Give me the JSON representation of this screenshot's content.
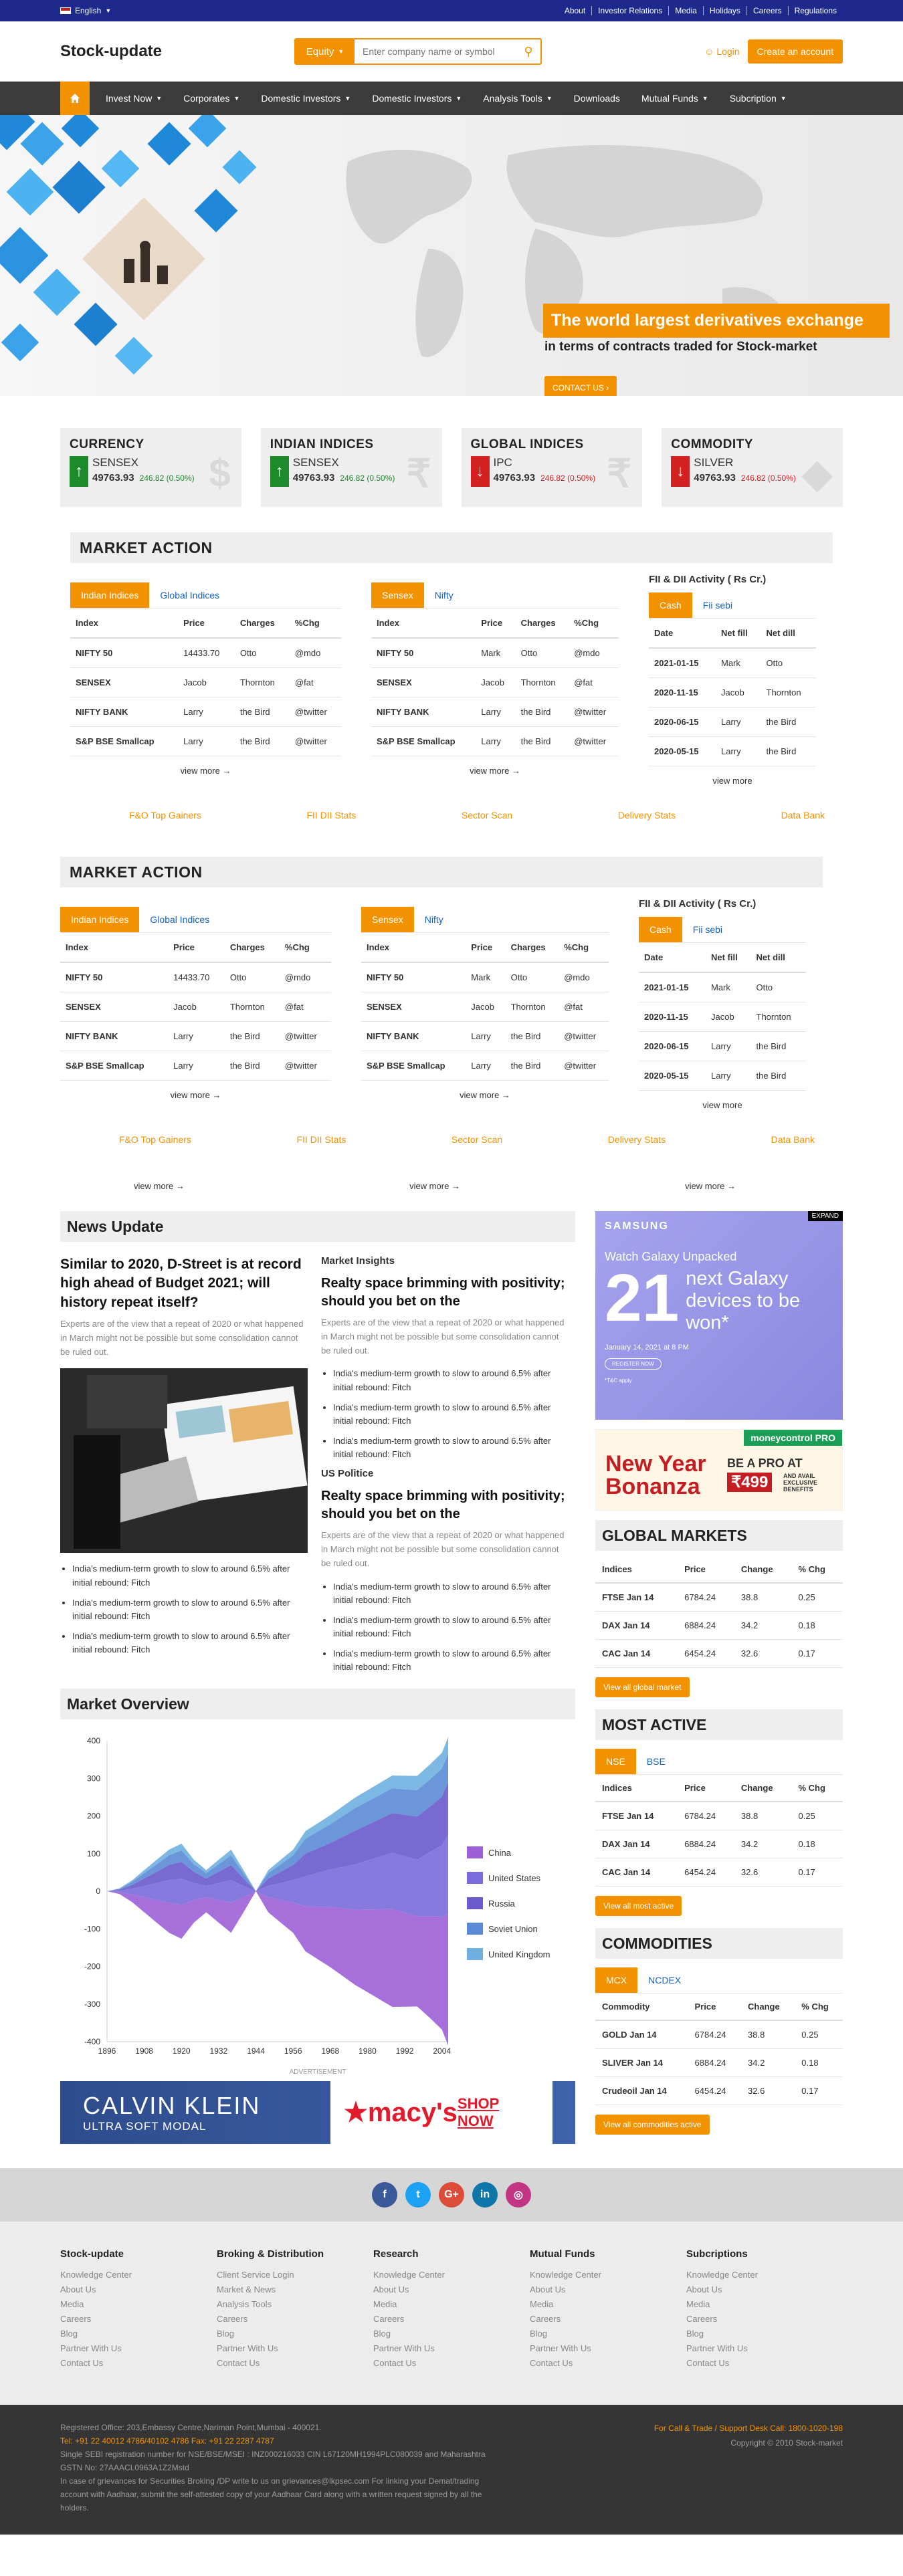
{
  "topbar": {
    "language": "English",
    "links": [
      "About",
      "Investor Relations",
      "Media",
      "Holidays",
      "Careers",
      "Regulations"
    ]
  },
  "header": {
    "logo": "Stock-update",
    "search_select": "Equity",
    "search_placeholder": "Enter company name or symbol",
    "login": "Login",
    "create_account": "Create an account"
  },
  "nav": {
    "items": [
      "Invest Now",
      "Corporates",
      "Domestic Investors",
      "Domestic Investors",
      "Analysis Tools",
      "Downloads",
      "Mutual Funds",
      "Subcription"
    ]
  },
  "hero": {
    "title": "The world largest derivatives exchange",
    "subtitle": "in terms of contracts traded for Stock-market",
    "button": "CONTACT US"
  },
  "cards": [
    {
      "title": "CURRENCY",
      "name": "SENSEX",
      "value": "49763.93",
      "change": "246.82 (0.50%)",
      "direction": "up",
      "symbol": "$"
    },
    {
      "title": "INDIAN INDICES",
      "name": "SENSEX",
      "value": "49763.93",
      "change": "246.82 (0.50%)",
      "direction": "up",
      "symbol": "₹"
    },
    {
      "title": "GLOBAL INDICES",
      "name": "IPC",
      "value": "49763.93",
      "change": "246.82 (0.50%)",
      "direction": "down",
      "symbol": "₹"
    },
    {
      "title": "COMMODITY",
      "name": "SILVER",
      "value": "49763.93",
      "change": "246.82 (0.50%)",
      "direction": "down",
      "symbol": "◆"
    }
  ],
  "market_action": {
    "title": "MARKET ACTION",
    "tabs1": [
      "Indian Indices",
      "Global Indices"
    ],
    "tabs2": [
      "Sensex",
      "Nifty"
    ],
    "headers": [
      "Index",
      "Price",
      "Charges",
      "%Chg"
    ],
    "rows1": [
      [
        "NIFTY 50",
        "14433.70",
        "Otto",
        "@mdo"
      ],
      [
        "SENSEX",
        "Jacob",
        "Thornton",
        "@fat"
      ],
      [
        "NIFTY BANK",
        "Larry",
        "the Bird",
        "@twitter"
      ],
      [
        "S&P BSE Smallcap",
        "Larry",
        "the Bird",
        "@twitter"
      ]
    ],
    "rows2": [
      [
        "NIFTY 50",
        "Mark",
        "Otto",
        "@mdo"
      ],
      [
        "SENSEX",
        "Jacob",
        "Thornton",
        "@fat"
      ],
      [
        "NIFTY BANK",
        "Larry",
        "the Bird",
        "@twitter"
      ],
      [
        "S&P BSE Smallcap",
        "Larry",
        "the Bird",
        "@twitter"
      ]
    ],
    "view_more": "view more",
    "fii_title": "FII & DII Activity ( Rs Cr.)",
    "fii_tabs": [
      "Cash",
      "Fii sebi"
    ],
    "fii_headers": [
      "Date",
      "Net fill",
      "Net dill"
    ],
    "fii_rows": [
      [
        "2021-01-15",
        "Mark",
        "Otto"
      ],
      [
        "2020-11-15",
        "Jacob",
        "Thornton"
      ],
      [
        "2020-06-15",
        "Larry",
        "the Bird"
      ],
      [
        "2020-05-15",
        "Larry",
        "the Bird"
      ]
    ],
    "links": [
      "F&O Top Gainers",
      "FII DII Stats",
      "Sector Scan",
      "Delivery Stats",
      "Data Bank"
    ]
  },
  "news": {
    "title": "News Update",
    "main_headline": "Similar to 2020, D-Street is at record high ahead of Budget 2021; will history repeat itself?",
    "main_text": "Experts are of the view that a repeat of 2020 or what happened in March might not be possible but some consolidation cannot be ruled out.",
    "bullet": "India's medium-term growth to slow to around 6.5% after initial rebound: Fitch",
    "insights_label": "Market Insights",
    "insights_headline": "Realty space brimming with positivity; should you bet on the",
    "insights_text": "Experts are of the view that a repeat of 2020 or what happened in March might not be possible but some consolidation cannot be ruled out.",
    "politics_label": "US Politice",
    "politics_headline": "Realty space brimming with positivity; should you bet on the",
    "politics_text": "Experts are of the view that a repeat of 2020 or what happened in March might not be possible but some consolidation cannot be ruled out."
  },
  "market_overview": {
    "title": "Market Overview"
  },
  "chart_data": {
    "type": "area",
    "x": [
      1896,
      1900,
      1904,
      1908,
      1912,
      1916,
      1920,
      1924,
      1928,
      1932,
      1936,
      1940,
      1944,
      1948,
      1952,
      1956,
      1960,
      1964,
      1968,
      1972,
      1976,
      1980,
      1984,
      1988,
      1992,
      1996,
      2000,
      2004,
      2006
    ],
    "x_ticks": [
      1896,
      1908,
      1920,
      1932,
      1944,
      1956,
      1968,
      1980,
      1992,
      2004
    ],
    "ylim": [
      -400,
      400
    ],
    "y_ticks": [
      400,
      300,
      200,
      100,
      0,
      -100,
      -200,
      -300,
      -400
    ],
    "series": [
      {
        "name": "China",
        "color": "#9c5fd6",
        "values": [
          0,
          5,
          20,
          40,
          60,
          80,
          90,
          60,
          40,
          60,
          80,
          40,
          0,
          40,
          60,
          80,
          120,
          140,
          160,
          180,
          200,
          220,
          240,
          260,
          250,
          240,
          270,
          300,
          350
        ]
      },
      {
        "name": "United States",
        "color": "#7a6bdc",
        "values": [
          0,
          4,
          15,
          30,
          45,
          60,
          70,
          45,
          30,
          45,
          60,
          30,
          0,
          30,
          45,
          60,
          80,
          90,
          100,
          110,
          120,
          130,
          140,
          150,
          150,
          150,
          170,
          190,
          210
        ]
      },
      {
        "name": "Russia",
        "color": "#6a5acd",
        "values": [
          0,
          3,
          10,
          20,
          30,
          40,
          45,
          30,
          20,
          30,
          40,
          20,
          0,
          20,
          30,
          40,
          60,
          65,
          70,
          80,
          90,
          95,
          100,
          105,
          110,
          115,
          120,
          130,
          140
        ]
      },
      {
        "name": "Soviet Union",
        "color": "#5b8bd6",
        "values": [
          0,
          2,
          8,
          14,
          20,
          26,
          30,
          20,
          14,
          20,
          26,
          14,
          0,
          14,
          20,
          26,
          40,
          45,
          50,
          55,
          60,
          62,
          64,
          66,
          68,
          70,
          72,
          74,
          76
        ]
      },
      {
        "name": "United Kingdom",
        "color": "#6fb0e0",
        "values": [
          0,
          1,
          4,
          8,
          12,
          15,
          18,
          12,
          8,
          12,
          15,
          8,
          0,
          8,
          12,
          15,
          20,
          22,
          24,
          26,
          28,
          30,
          32,
          34,
          36,
          38,
          40,
          42,
          44
        ]
      }
    ]
  },
  "sidebar": {
    "ad1": {
      "brand": "SAMSUNG",
      "expand": "EXPAND",
      "line1": "Watch Galaxy Unpacked",
      "big": "21",
      "line2": "next Galaxy devices to be won*",
      "date": "January 14, 2021 at 8 PM",
      "register": "REGISTER NOW",
      "tc": "*T&C apply"
    },
    "ad2": {
      "brand": "moneycontrol PRO",
      "headline": "New Year Bonanza",
      "pro": "BE A PRO AT",
      "price": "₹499",
      "offer": "AND AVAIL EXCLUSIVE BENEFITS"
    },
    "global_markets": {
      "title": "GLOBAL MARKETS",
      "headers": [
        "Indices",
        "Price",
        "Change",
        "% Chg"
      ],
      "rows": [
        [
          "FTSE Jan 14",
          "6784.24",
          "38.8",
          "0.25"
        ],
        [
          "DAX Jan 14",
          "6884.24",
          "34.2",
          "0.18"
        ],
        [
          "CAC Jan 14",
          "6454.24",
          "32.6",
          "0.17"
        ]
      ],
      "button": "View all global market"
    },
    "most_active": {
      "title": "MOST ACTIVE",
      "tabs": [
        "NSE",
        "BSE"
      ],
      "headers": [
        "Indices",
        "Price",
        "Change",
        "% Chg"
      ],
      "rows": [
        [
          "FTSE Jan 14",
          "6784.24",
          "38.8",
          "0.25"
        ],
        [
          "DAX Jan 14",
          "6884.24",
          "34.2",
          "0.18"
        ],
        [
          "CAC Jan 14",
          "6454.24",
          "32.6",
          "0.17"
        ]
      ],
      "button": "View all most active"
    },
    "commodities": {
      "title": "COMMODITIES",
      "tabs": [
        "MCX",
        "NCDEX"
      ],
      "headers": [
        "Commodity",
        "Price",
        "Change",
        "% Chg"
      ],
      "rows": [
        [
          "GOLD Jan 14",
          "6784.24",
          "38.8",
          "0.25"
        ],
        [
          "SLIVER Jan 14",
          "6884.24",
          "34.2",
          "0.18"
        ],
        [
          "Crudeoil Jan 14",
          "6454.24",
          "32.6",
          "0.17"
        ]
      ],
      "button": "View all commodities active"
    }
  },
  "advertisement": {
    "label": "ADVERTISEMENT",
    "brand": "CALVIN KLEIN",
    "sub": "ULTRA SOFT MODAL",
    "store": "macy's",
    "cta": "SHOP NOW"
  },
  "footer": {
    "columns": [
      {
        "title": "Stock-update",
        "links": [
          "Knowledge Center",
          "About Us",
          "Media",
          "Careers",
          "Blog",
          "Partner With Us",
          "Contact Us"
        ]
      },
      {
        "title": "Broking & Distribution",
        "links": [
          "Client Service Login",
          "Market & News",
          "Analysis Tools",
          "Careers",
          "Blog",
          "Partner With Us",
          "Contact Us"
        ]
      },
      {
        "title": "Research",
        "links": [
          "Knowledge Center",
          "About Us",
          "Media",
          "Careers",
          "Blog",
          "Partner With Us",
          "Contact Us"
        ]
      },
      {
        "title": "Mutual Funds",
        "links": [
          "Knowledge Center",
          "About Us",
          "Media",
          "Careers",
          "Blog",
          "Partner With Us",
          "Contact Us"
        ]
      },
      {
        "title": "Subcriptions",
        "links": [
          "Knowledge Center",
          "About Us",
          "Media",
          "Careers",
          "Blog",
          "Partner With Us",
          "Contact Us"
        ]
      }
    ],
    "address": "Registered Office: 203,Embassy Centre,Nariman Point,Mumbai - 400021.",
    "tel": "Tel: +91 22 40012 4786/40102 4786 Fax: +91 22 2287 4787",
    "sebi": "Single SEBI registration number for NSE/BSE/MSEI : INZ000216033 CIN L67120MH1994PLC080039 and Maharashtra",
    "gstn": "GSTN No: 27AAACL0963A1Z2Mstd",
    "grievance": "In case of grievances for Securities Broking /DP write to us on grievances@lkpsec.com For linking your Demat/trading account with Aadhaar, submit the self-attested copy of your Aadhaar Card along with a written request signed by all the holders.",
    "call": "For Call & Trade / Support Desk Call: 1800-1020-198",
    "copyright": "Copyright © 2010 Stock-market"
  }
}
